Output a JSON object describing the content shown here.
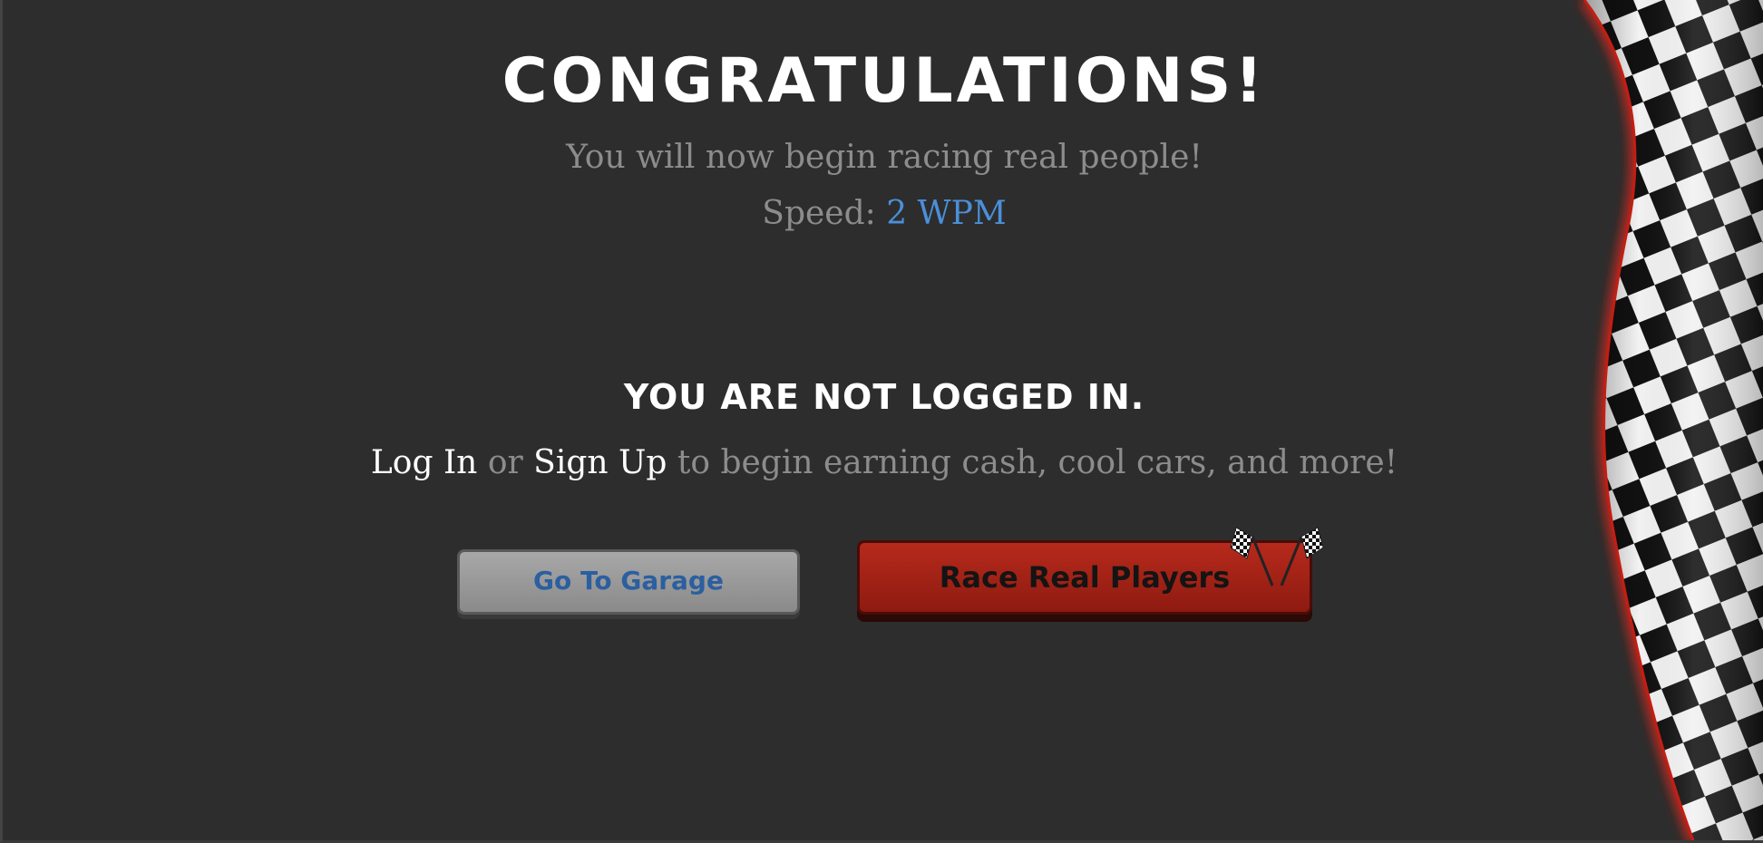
{
  "modal": {
    "title": "CONGRATULATIONS!",
    "subtitle": "You will now begin racing real people!",
    "speed_label": "Speed:",
    "speed_value": "2 WPM",
    "not_logged_in": "YOU ARE NOT LOGGED IN.",
    "login_link": "Log In",
    "or_text": "or",
    "signup_link": "Sign Up",
    "invite_text": "to begin earning cash, cool cars, and more!"
  },
  "buttons": {
    "garage_label": "Go To Garage",
    "race_label": "Race Real Players"
  },
  "colors": {
    "background": "#2d2d2d",
    "speed_accent": "#4a90d9",
    "race_button": "#a82316",
    "garage_button": "#9a9a9a"
  },
  "icons": [
    "checkered-flag-icon",
    "crossed-flags-icon"
  ]
}
